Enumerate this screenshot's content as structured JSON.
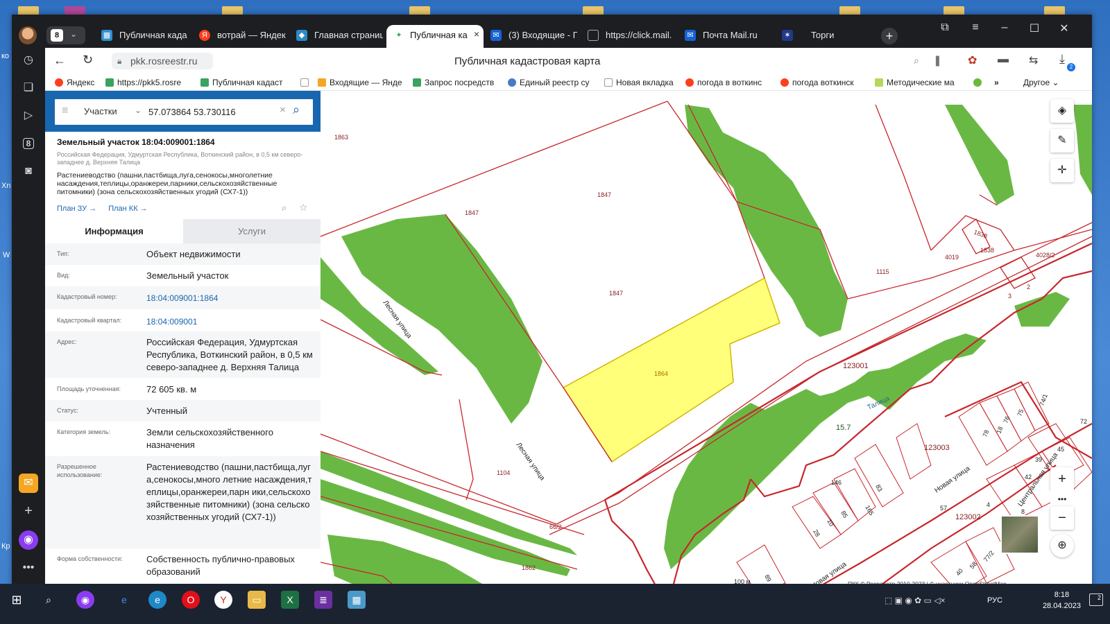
{
  "desktop": {
    "labels": [
      "ко",
      "Xn",
      "W",
      "Кр"
    ]
  },
  "browser": {
    "tab_count": "8",
    "tabs": [
      {
        "label": "Публичная када",
        "icon_color": "#2f8fd0"
      },
      {
        "label": "вотрай — Яндек",
        "icon_color": "#fc3f1d"
      },
      {
        "label": "Главная страниц",
        "icon_color": "#2c8ac6"
      },
      {
        "label": "Публичная ка",
        "icon_color": "#3aa35f"
      },
      {
        "label": "(3) Входящие - П",
        "icon_color": "#1563d6"
      },
      {
        "label": "https://click.mail.",
        "icon_color": "#888888"
      },
      {
        "label": "Почта Mail.ru",
        "icon_color": "#1563d6"
      },
      {
        "label": "Торги",
        "icon_color": "#1f3a8a"
      }
    ],
    "url": "pkk.rosreestr.ru",
    "page_title": "Публичная кадастровая карта",
    "downloads_badge": "2",
    "bookmarks": [
      {
        "label": "Яндекс",
        "color": "#fc3f1d"
      },
      {
        "label": "https://pkk5.rosre",
        "color": "#3aa35f"
      },
      {
        "label": "Публичная кадаст",
        "color": "#3aa35f"
      },
      {
        "label": "",
        "color": "#ffffff"
      },
      {
        "label": "Входящие — Янде",
        "color": "#f5a623"
      },
      {
        "label": "Запрос посредств",
        "color": "#3aa35f"
      },
      {
        "label": "Единый реестр су",
        "color": "#4a7ac2"
      },
      {
        "label": "Новая вкладка",
        "color": "#ffffff"
      },
      {
        "label": "погода в воткинс",
        "color": "#fc3f1d"
      },
      {
        "label": "погода воткинск",
        "color": "#fc3f1d"
      },
      {
        "label": "Методические ма",
        "color": "#b6d85a"
      },
      {
        "label": "",
        "color": "#6bb83a"
      }
    ],
    "bookmarks_more": "Другое"
  },
  "search": {
    "type": "Участки",
    "query": "57.073864 53.730116"
  },
  "parcel": {
    "title": "Земельный участок 18:04:009001:1864",
    "address_short": "Российская Федерация, Удмуртская Республика, Воткинский район, в 0,5 км северо-западнее д. Верхняя Талица",
    "use_short": "Растениеводство (пашни,пастбища,луга,сенокосы,многолетние насаждения,теплицы,оранжереи,парники,сельскохозяйственные питомники) (зона сельскохозяйственных угодий (СХ7-1))",
    "link_plan_zu": "План ЗУ",
    "link_plan_kk": "План КК"
  },
  "info_tabs": [
    "Информация",
    "Услуги"
  ],
  "info_rows": [
    {
      "label": "Тип:",
      "value": "Объект недвижимости"
    },
    {
      "label": "Вид:",
      "value": "Земельный участок"
    },
    {
      "label": "Кадастровый номер:",
      "value": "18:04:009001:1864"
    },
    {
      "label": "Кадастровый квартал:",
      "value": "18:04:009001"
    },
    {
      "label": "Адрес:",
      "value": "Российская Федерация, Удмуртская Республика, Воткинский район, в 0,5 км северо-западнее д. Верхняя Талица"
    },
    {
      "label": "Площадь уточненная:",
      "value": "72 605 кв. м"
    },
    {
      "label": "Статус:",
      "value": "Учтенный"
    },
    {
      "label": "Категория земель:",
      "value": "Земли сельскохозяйственного назначения"
    },
    {
      "label": "Разрешенное использование:",
      "value": "Растениеводство (пашни,пастбища,луга,сенокосы,много летние насаждения,теплицы,оранжереи,парн ики,сельскохозяйственные питомники) (зона сельскохозяйственных угодий (СХ7-1))"
    },
    {
      "label": "Форма собственности:",
      "value": "Собственность публично-правовых образований"
    }
  ],
  "map": {
    "labels": {
      "p1863": "1863",
      "p1847a": "1847",
      "p1847b": "1847",
      "p1847c": "1847",
      "p1864": "1864",
      "p1104": "1104",
      "p66_2": "66/2",
      "p1862": "1862",
      "p1115": "1115",
      "p1838a": "1838",
      "p1838b": "1838",
      "p4019": "4019",
      "p4028_2": "4028/2",
      "p2": "2",
      "p3": "3",
      "q123001": "123001",
      "q123003": "123003",
      "q123002": "123002",
      "p15_7": "15.7",
      "p146": "146",
      "street_les1": "Лесная улица",
      "street_les2": "Лесная улица",
      "street_nov1": "Новая улица",
      "street_nov2": "Новая улица",
      "street_centr": "Центральная улица",
      "river": "Талица",
      "n83": "83",
      "n85": "85",
      "n165": "165",
      "n10": "10",
      "n28": "28",
      "n57": "57",
      "n4": "4",
      "n8": "8",
      "n42": "42",
      "n39": "39",
      "n45": "45",
      "n72": "72",
      "n74": "74/1",
      "n75": "75",
      "n76": "76",
      "n78": "78",
      "n18": "18",
      "n40": "40",
      "n58": "58",
      "n77": "77/2",
      "n89": "89"
    },
    "scale": "100 м",
    "attribution": "ПКК © Росреестр 2010-2023 | © участники OpenStreetMap",
    "colors": {
      "green": "#6ab844",
      "parcel": "#ffff7a",
      "border": "#c8262c"
    }
  },
  "taskbar": {
    "time": "8:18",
    "date": "28.04.2023",
    "lang": "РУС",
    "notif": "2"
  }
}
